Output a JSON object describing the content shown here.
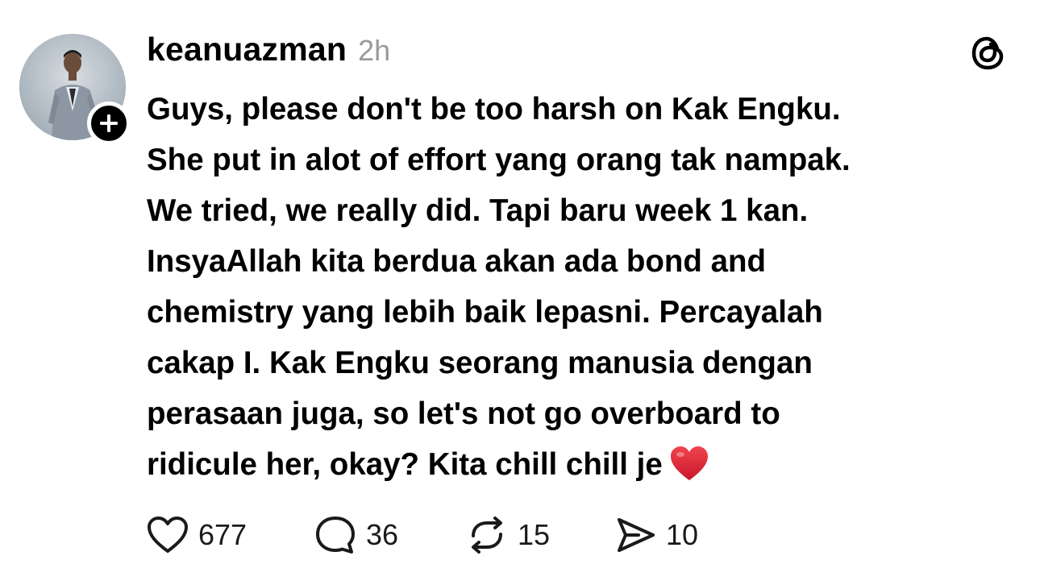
{
  "post": {
    "username": "keanuazman",
    "timestamp": "2h",
    "text": "Guys, please don't be too harsh on Kak Engku. She put in alot of effort yang orang tak nampak. We tried, we really did. Tapi baru week 1 kan. InsyaAllah kita berdua akan ada bond and chemistry yang lebih baik lepasni. Percayalah cakap I. Kak Engku seorang manusia dengan perasaan juga, so let's not go overboard to ridicule her, okay? Kita chill chill je",
    "emoji": "red-heart",
    "lines": [
      "Guys, please don't be too harsh on Kak Engku.",
      "She put in alot of effort yang orang tak nampak.",
      "We tried, we really did. Tapi baru week 1 kan.",
      "InsyaAllah kita berdua akan ada bond and",
      "chemistry yang lebih baik lepasni. Percayalah",
      "cakap I. Kak Engku seorang manusia dengan",
      "perasaan juga, so let's not go overboard to",
      "ridicule her, okay? Kita chill chill je"
    ]
  },
  "actions": {
    "likes": "677",
    "replies": "36",
    "reposts": "15",
    "shares": "10"
  },
  "icons": {
    "follow": "plus-icon",
    "brand": "threads-logo-icon",
    "like": "heart-icon",
    "reply": "speech-bubble-icon",
    "repost": "repost-icon",
    "share": "send-icon"
  },
  "colors": {
    "text": "#000000",
    "muted": "#9a9a9a",
    "heart": "#e0243a",
    "badge": "#000000"
  }
}
